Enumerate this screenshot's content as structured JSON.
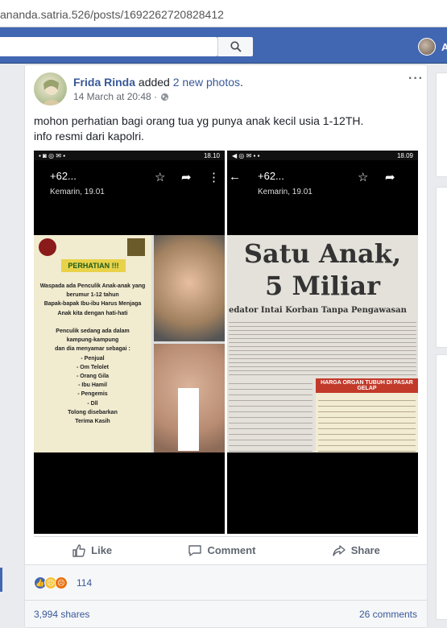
{
  "browser": {
    "url": "ananda.satria.526/posts/1692262720828412"
  },
  "topbar": {
    "user_short": "A"
  },
  "post": {
    "author": "Frida Rinda",
    "action_text": " added ",
    "action_link": "2 new photos",
    "action_end": ".",
    "timestamp": "14 March at 20:48 ·",
    "more": "···",
    "text_line1": "mohon perhatian bagi orang tua yg punya anak kecil usia 1-12TH.",
    "text_line2": "info resmi dari kapolri."
  },
  "photo_left": {
    "status_time": "18.10",
    "contact": "+62...",
    "date": "Kemarin, 19.01",
    "poster_title": "PERHATIAN !!!",
    "poster_lines": [
      "Waspada ada Penculik Anak-anak yang",
      "berumur 1-12 tahun",
      "Bapak-bapak Ibu-ibu Harus Menjaga",
      "Anak kita dengan hati-hati",
      "",
      "Penculik sedang ada dalam",
      "kampung-kampung",
      "dan dia menyamar sebagai :",
      "- Penjual",
      "- Om Telolet",
      "- Orang Gila",
      "- Ibu Hamil",
      "- Pengemis",
      "- Dll",
      "Tolong disebarkan",
      "Terima Kasih"
    ]
  },
  "photo_right": {
    "status_time": "18.09",
    "contact": "+62...",
    "date": "Kemarin, 19.01",
    "headline1": "Satu Anak,",
    "headline2": "5 Miliar",
    "subhead": "edator Intai Korban Tanpa Pengawasan",
    "box_title": "HARGA ORGAN TUBUH DI PASAR GELAP"
  },
  "actions": {
    "like": "Like",
    "comment": "Comment",
    "share": "Share"
  },
  "reactions": {
    "count": "114"
  },
  "footer": {
    "shares": "3,994 shares",
    "comments": "26 comments"
  },
  "colors": {
    "fb_blue": "#4267b2",
    "link": "#385898",
    "bg": "#e9ebee"
  }
}
